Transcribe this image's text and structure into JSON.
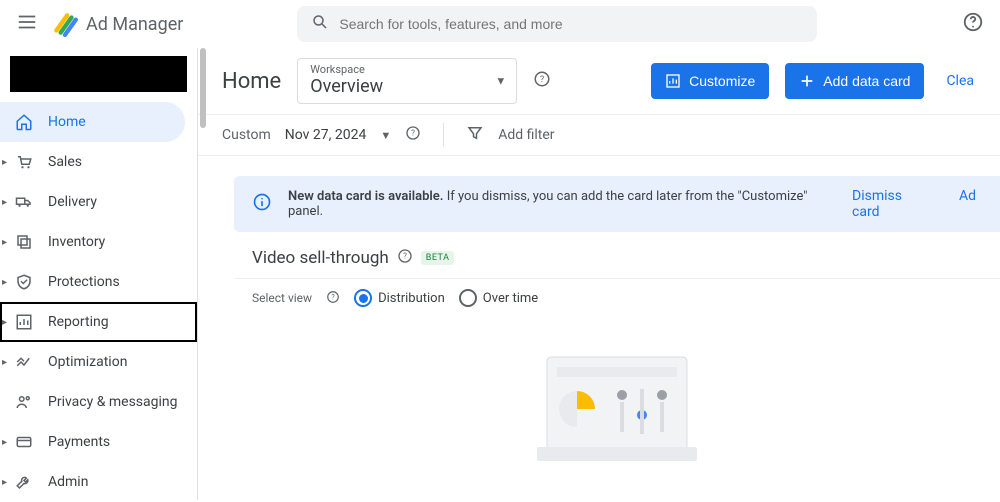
{
  "app": {
    "name": "Ad Manager"
  },
  "search": {
    "placeholder": "Search for tools, features, and more"
  },
  "sidebar": {
    "items": [
      {
        "label": "Home"
      },
      {
        "label": "Sales"
      },
      {
        "label": "Delivery"
      },
      {
        "label": "Inventory"
      },
      {
        "label": "Protections"
      },
      {
        "label": "Reporting"
      },
      {
        "label": "Optimization"
      },
      {
        "label": "Privacy & messaging"
      },
      {
        "label": "Payments"
      },
      {
        "label": "Admin"
      }
    ]
  },
  "header": {
    "page_title": "Home",
    "workspace_label": "Workspace",
    "workspace_value": "Overview",
    "customize": "Customize",
    "add_card": "Add data card",
    "clear": "Clea"
  },
  "filters": {
    "range_label": "Custom",
    "date": "Nov 27, 2024",
    "add_filter": "Add filter"
  },
  "notice": {
    "text_prefix": "New data card is available.",
    "text_rest": " If you dismiss, you can add the card later from the \"Customize\" panel.",
    "dismiss": "Dismiss card",
    "add": "Ad"
  },
  "card": {
    "title": "Video sell-through",
    "beta": "BETA",
    "select_view_label": "Select view",
    "opt_distribution": "Distribution",
    "opt_overtime": "Over time"
  }
}
